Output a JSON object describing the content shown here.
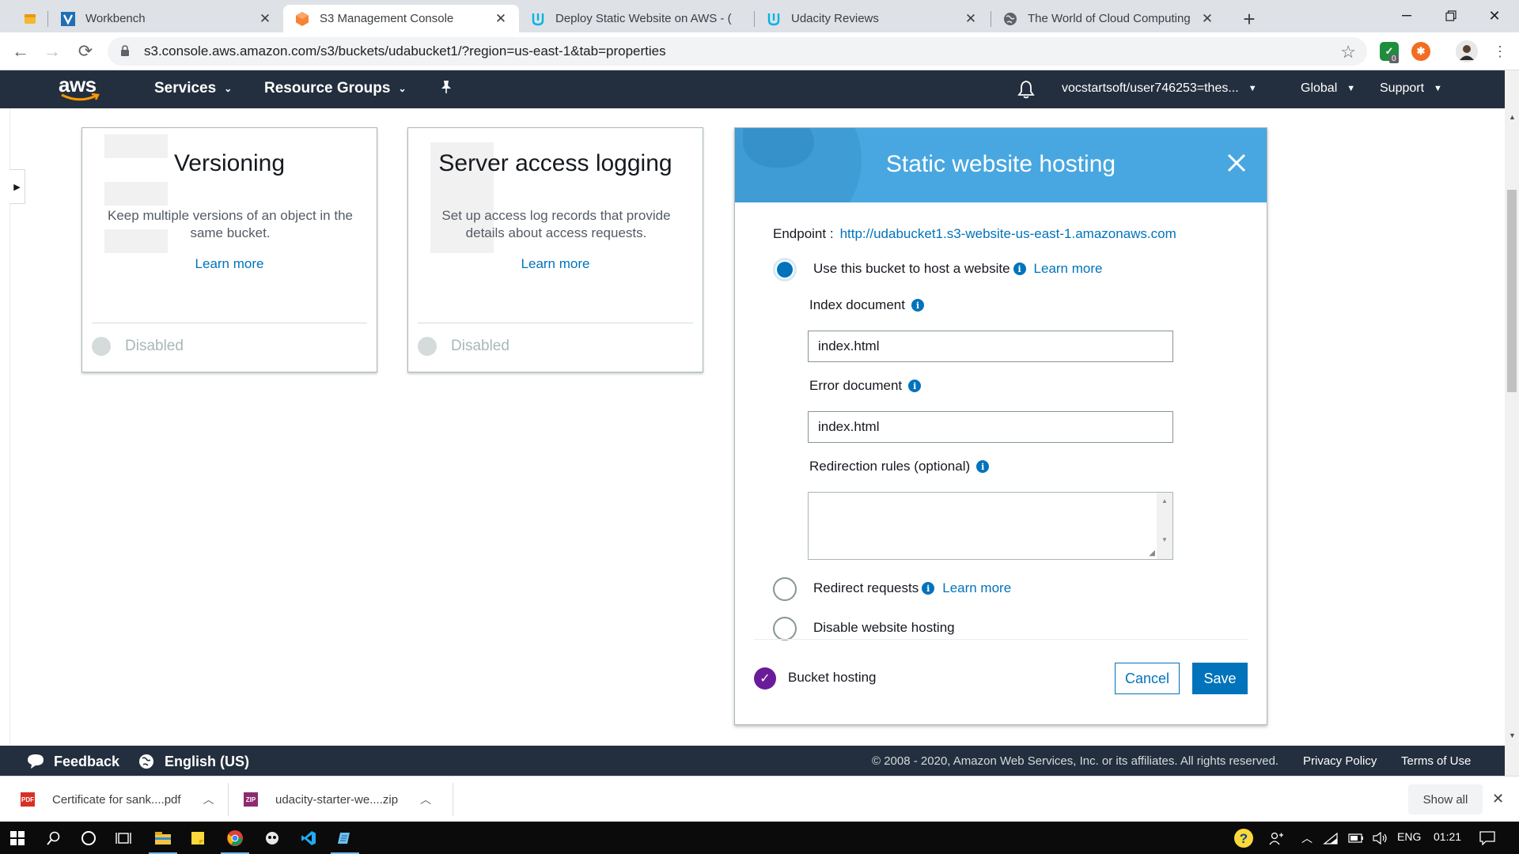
{
  "browser": {
    "tabs": [
      {
        "title": "",
        "icon": "aws-box-icon"
      },
      {
        "title": "Workbench",
        "icon": "vocareum-icon"
      },
      {
        "title": "S3 Management Console",
        "icon": "aws-s3-icon"
      },
      {
        "title": "Deploy Static Website on AWS - (",
        "icon": "udacity-icon"
      },
      {
        "title": "Udacity Reviews",
        "icon": "udacity-icon"
      },
      {
        "title": "The World of Cloud Computing",
        "icon": "globe-icon"
      }
    ],
    "url": "s3.console.aws.amazon.com/s3/buckets/udabucket1/?region=us-east-1&tab=properties",
    "extension_badge": "0"
  },
  "aws_nav": {
    "logo": "aws",
    "services": "Services",
    "resource_groups": "Resource Groups",
    "account": "vocstartsoft/user746253=thes...",
    "region": "Global",
    "support": "Support"
  },
  "cards": [
    {
      "title": "Versioning",
      "description": "Keep multiple versions of an object in the same bucket.",
      "learn_more": "Learn more",
      "status": "Disabled"
    },
    {
      "title": "Server access logging",
      "description": "Set up access log records that provide details about access requests.",
      "learn_more": "Learn more",
      "status": "Disabled"
    }
  ],
  "hosting_panel": {
    "title": "Static website hosting",
    "endpoint_label": "Endpoint :",
    "endpoint_url": "http://udabucket1.s3-website-us-east-1.amazonaws.com",
    "option_host": "Use this bucket to host a website",
    "option_host_selected": true,
    "learn_more": "Learn more",
    "index_label": "Index document",
    "index_value": "index.html",
    "error_label": "Error document",
    "error_value": "index.html",
    "redirection_label": "Redirection rules (optional)",
    "redirection_value": "",
    "option_redirect": "Redirect requests",
    "option_disable": "Disable website hosting",
    "bucket_hosting": "Bucket hosting",
    "cancel": "Cancel",
    "save": "Save"
  },
  "footer": {
    "feedback": "Feedback",
    "language": "English (US)",
    "copyright": "© 2008 - 2020, Amazon Web Services, Inc. or its affiliates. All rights reserved.",
    "privacy": "Privacy Policy",
    "terms": "Terms of Use"
  },
  "downloads": {
    "items": [
      {
        "name": "Certificate for sank....pdf",
        "type": "PDF"
      },
      {
        "name": "udacity-starter-we....zip",
        "type": "ZIP"
      }
    ],
    "show_all": "Show all"
  },
  "taskbar": {
    "language": "ENG",
    "time": "01:21"
  },
  "colors": {
    "aws_nav": "#232f3e",
    "panel_header": "#48a7e0",
    "link": "#0073bb",
    "bucket_hosting_check": "#6a1b9a"
  }
}
